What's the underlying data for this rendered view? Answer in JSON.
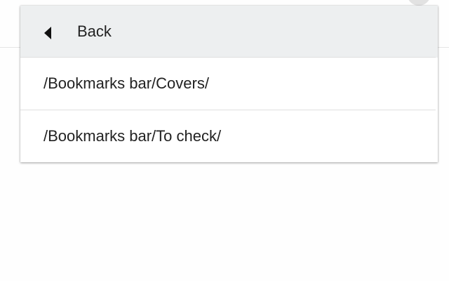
{
  "menu": {
    "back_label": "Back",
    "back_icon": "triangle-left-icon",
    "items": [
      {
        "label": "/Bookmarks bar/Covers/"
      },
      {
        "label": "/Bookmarks bar/To check/"
      }
    ]
  },
  "colors": {
    "back_row_background": "#edeff0",
    "text": "#222222",
    "divider": "#dfdfdf"
  }
}
